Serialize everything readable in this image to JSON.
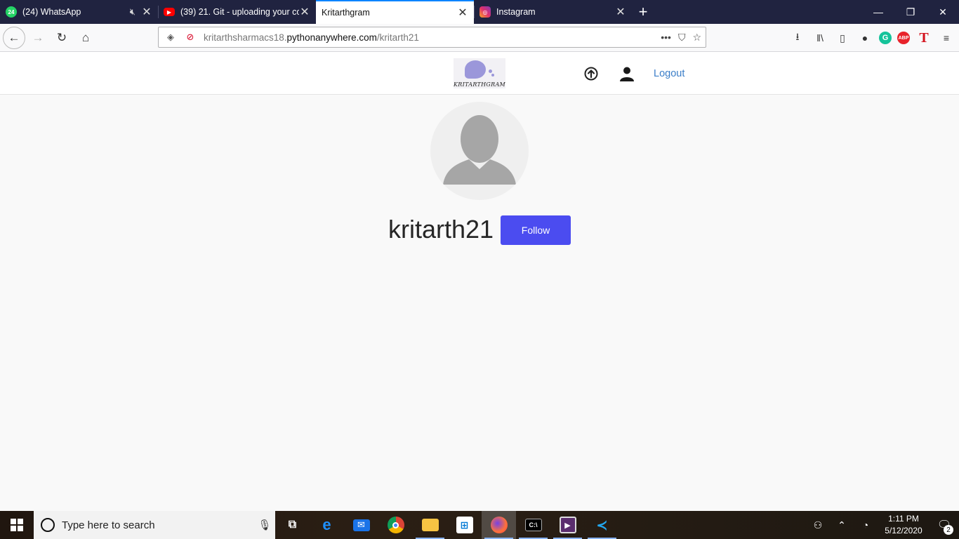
{
  "browser": {
    "tabs": [
      {
        "title": "(24) WhatsApp",
        "favicon": "whatsapp-icon",
        "badge": "24"
      },
      {
        "title": "(39) 21. Git - uploading your co",
        "favicon": "youtube-icon"
      },
      {
        "title": "Kritarthgram",
        "favicon": "",
        "active": true
      },
      {
        "title": "Instagram",
        "favicon": "instagram-icon"
      }
    ],
    "url_prefix": "kritarthsharmacs18.",
    "url_domain": "pythonanywhere.com",
    "url_path": "/kritarth21"
  },
  "site": {
    "logo_text": "KRITARTHGRAM",
    "logout_label": "Logout"
  },
  "profile": {
    "username": "kritarth21",
    "follow_label": "Follow"
  },
  "taskbar": {
    "search_placeholder": "Type here to search",
    "time": "1:11 PM",
    "date": "5/12/2020",
    "notification_count": "2"
  },
  "colors": {
    "tabstrip": "#202340",
    "follow_button": "#4b4cf0",
    "logout_link": "#3b7ec8",
    "accent": "#0a84ff"
  }
}
